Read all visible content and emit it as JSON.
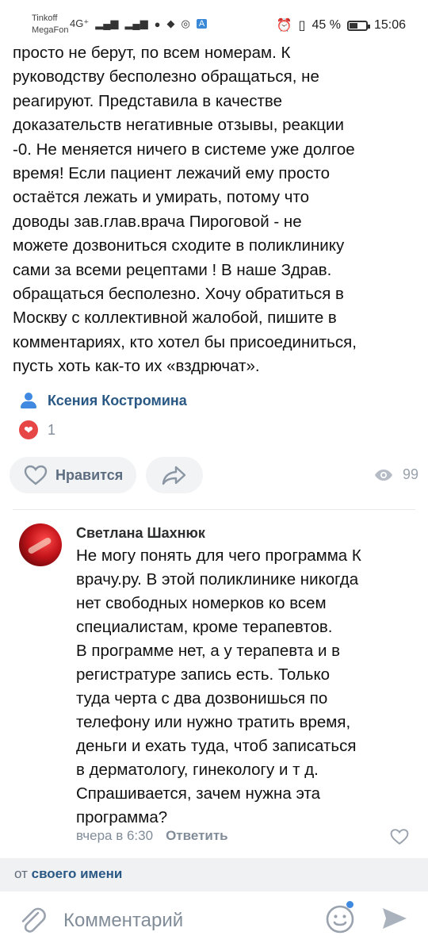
{
  "status_bar": {
    "carrier_1": "Tinkoff",
    "carrier_2": "MegaFon",
    "network": "4G⁺",
    "battery_percent": "45 %",
    "time": "15:06",
    "badge": "A"
  },
  "post": {
    "text": "просто не берут, по всем номерам. К\nруководству бесполезно обращаться, не\nреагируют. Представила в качестве\nдоказательств негативные отзывы, реакции\n-0. Не меняется ничего в системе уже долгое\nвремя! Если пациент лежачий ему просто\nостаётся лежать и умирать, потому что\nдоводы зав.глав.врача Пироговой - не\nможете дозвониться сходите в поликлинику\nсами за всеми рецептами ! В наше Здрав.\nобращаться бесполезно. Хочу обратиться в\nМоскву с коллективной жалобой, пишите в\nкомментариях, кто хотел бы присоединиться,\nпусть хоть как-то их «вздрючат».",
    "author": "Ксения Костромина",
    "reaction_count": "1",
    "like_label": "Нравится",
    "views": "99"
  },
  "comment": {
    "author": "Светлана Шахнюк",
    "text": "Не могу понять для чего программа К\nврачу.ру. В этой поликлинике никогда\nнет свободных номерков ко всем\nспециалистам, кроме терапевтов.\nВ программе нет, а у терапевта  и в\nрегистратуре запись есть. Только\nтуда черта с два дозвонишься по\nтелефону или нужно тратить время,\nденьги и ехать туда, чтоб записаться\nв дерматологу,  гинекологу и т д.\nСпрашивается, зачем нужна эта\nпрограмма?",
    "time": "вчера в 6:30",
    "reply_label": "Ответить"
  },
  "composer": {
    "from_prefix": "от",
    "from_link": "своего имени",
    "placeholder": "Комментарий"
  },
  "colors": {
    "link": "#2a5885",
    "accent": "#3f8ae0",
    "heart": "#e64646"
  }
}
